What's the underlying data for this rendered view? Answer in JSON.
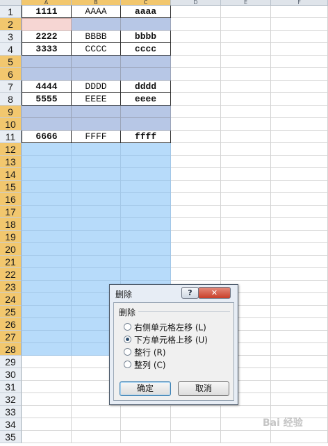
{
  "columns": [
    "A",
    "B",
    "C",
    "D",
    "E",
    "F"
  ],
  "rows": [
    {
      "num": "1",
      "a": "1111",
      "b": "AAAA",
      "c": "aaaa",
      "style": "data"
    },
    {
      "num": "2",
      "a": "",
      "b": "",
      "c": "",
      "style": "hl"
    },
    {
      "num": "3",
      "a": "2222",
      "b": "BBBB",
      "c": "bbbb",
      "style": "data"
    },
    {
      "num": "4",
      "a": "3333",
      "b": "CCCC",
      "c": "cccc",
      "style": "data"
    },
    {
      "num": "5",
      "a": "",
      "b": "",
      "c": "",
      "style": "hl"
    },
    {
      "num": "6",
      "a": "",
      "b": "",
      "c": "",
      "style": "hl"
    },
    {
      "num": "7",
      "a": "4444",
      "b": "DDDD",
      "c": "dddd",
      "style": "data"
    },
    {
      "num": "8",
      "a": "5555",
      "b": "EEEE",
      "c": "eeee",
      "style": "data"
    },
    {
      "num": "9",
      "a": "",
      "b": "",
      "c": "",
      "style": "hl"
    },
    {
      "num": "10",
      "a": "",
      "b": "",
      "c": "",
      "style": "hl"
    },
    {
      "num": "11",
      "a": "6666",
      "b": "FFFF",
      "c": "ffff",
      "style": "data"
    },
    {
      "num": "12",
      "style": "sel"
    },
    {
      "num": "13",
      "style": "sel"
    },
    {
      "num": "14",
      "style": "sel"
    },
    {
      "num": "15",
      "style": "sel"
    },
    {
      "num": "16",
      "style": "sel"
    },
    {
      "num": "17",
      "style": "sel"
    },
    {
      "num": "18",
      "style": "sel"
    },
    {
      "num": "19",
      "style": "sel"
    },
    {
      "num": "20",
      "style": "sel"
    },
    {
      "num": "21",
      "style": "sel"
    },
    {
      "num": "22",
      "style": "sel"
    },
    {
      "num": "23",
      "style": "sel"
    },
    {
      "num": "24",
      "style": "sel"
    },
    {
      "num": "25",
      "style": "sel"
    },
    {
      "num": "26",
      "style": "sel"
    },
    {
      "num": "27",
      "style": "sel"
    },
    {
      "num": "28",
      "style": "sel"
    },
    {
      "num": "29",
      "style": "none"
    },
    {
      "num": "30",
      "style": "none"
    },
    {
      "num": "31",
      "style": "none"
    },
    {
      "num": "32",
      "style": "none"
    },
    {
      "num": "33",
      "style": "none"
    },
    {
      "num": "34",
      "style": "none"
    },
    {
      "num": "35",
      "style": "none"
    }
  ],
  "dialog": {
    "title": "删除",
    "help_label": "?",
    "close_label": "✕",
    "group_label": "删除",
    "options": [
      {
        "label": "右侧单元格左移 (L)",
        "selected": false
      },
      {
        "label": "下方单元格上移 (U)",
        "selected": true
      },
      {
        "label": "整行 (R)",
        "selected": false
      },
      {
        "label": "整列 (C)",
        "selected": false
      }
    ],
    "ok_label": "确定",
    "cancel_label": "取消"
  },
  "watermark": "Bai 经验",
  "colors": {
    "highlight_rows": "#b7c7e6",
    "selection": "#b7dbfa",
    "active_cell": "#f6d6d3",
    "header_selected": "#f2c76e"
  }
}
